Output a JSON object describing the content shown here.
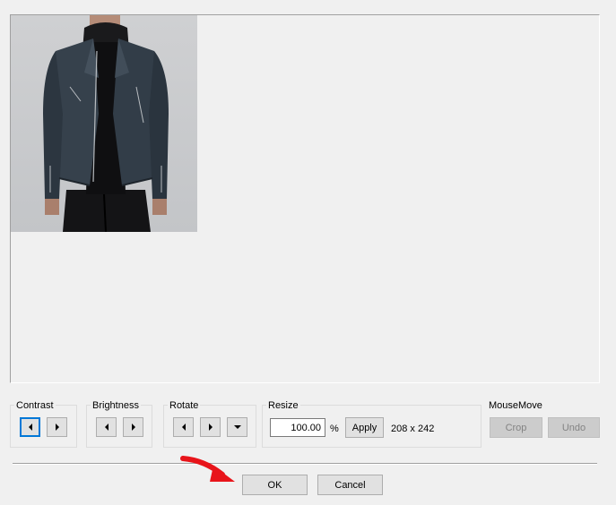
{
  "contrast": {
    "label": "Contrast"
  },
  "brightness": {
    "label": "Brightness"
  },
  "rotate": {
    "label": "Rotate"
  },
  "resize": {
    "label": "Resize",
    "value": "100.00",
    "unit": "%",
    "apply_label": "Apply",
    "dimensions": "208 x 242"
  },
  "mousemove": {
    "label": "MouseMove",
    "crop_label": "Crop",
    "undo_label": "Undo"
  },
  "dialog": {
    "ok_label": "OK",
    "cancel_label": "Cancel"
  },
  "icons": {
    "decrease": "triangle-left-icon",
    "increase": "triangle-right-icon",
    "rotate_menu": "triangle-down-icon",
    "pointer": "red-arrow-icon"
  },
  "colors": {
    "focus": "#0078d7",
    "arrow": "#e8141a"
  }
}
